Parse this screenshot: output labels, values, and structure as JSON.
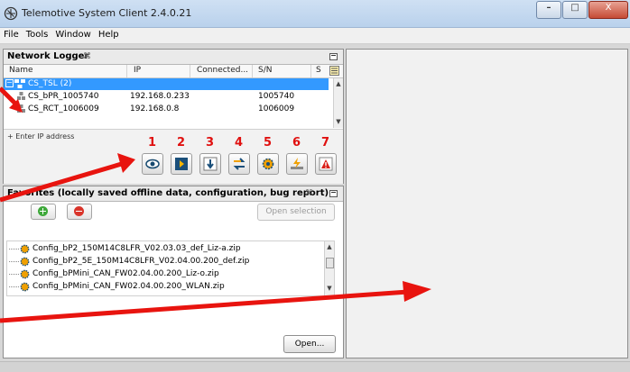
{
  "window": {
    "title": "Telemotive System Client 2.4.0.21",
    "min": "–",
    "max": "□",
    "close": "X"
  },
  "menu": [
    "File",
    "Tools",
    "Window",
    "Help"
  ],
  "network_logger": {
    "title": "Network Logger",
    "close_glyph": "⌘",
    "columns": [
      "Name",
      "IP",
      "Connected...",
      "S/N",
      "S"
    ],
    "rows": [
      {
        "name": "CS_TSL (2)",
        "ip": "",
        "connected": "",
        "sn": ""
      },
      {
        "name": "CS_bPR_1005740",
        "ip": "192.168.0.233",
        "connected": "",
        "sn": "1005740"
      },
      {
        "name": "CS_RCT_1006009",
        "ip": "192.168.0.8",
        "connected": "",
        "sn": "1006009"
      }
    ],
    "enter_ip": "+ Enter IP address",
    "tool_numbers": [
      "1",
      "2",
      "3",
      "4",
      "5",
      "6",
      "7"
    ],
    "tool_icons": [
      "eye-icon",
      "play-icon",
      "download-icon",
      "swap-icon",
      "gear-icon",
      "flash-icon",
      "warning-icon"
    ]
  },
  "favorites": {
    "title": "Favorites (locally saved offline data, configuration, bug report)",
    "close_glyph": "⌘",
    "open_selection": "Open selection",
    "items": [
      "Config_bP2_150M14C8LFR_V02.03.03_def_Liz-a.zip",
      "Config_bP2_5E_150M14C8LFR_V02.04.00.200_def.zip",
      "Config_bPMini_CAN_FW02.04.00.200_Liz-o.zip",
      "Config_bPMini_CAN_FW02.04.00.200_WLAN.zip"
    ],
    "open_button": "Open..."
  },
  "colors": {
    "accent_red": "#e0100f",
    "selection": "#3399ff"
  }
}
